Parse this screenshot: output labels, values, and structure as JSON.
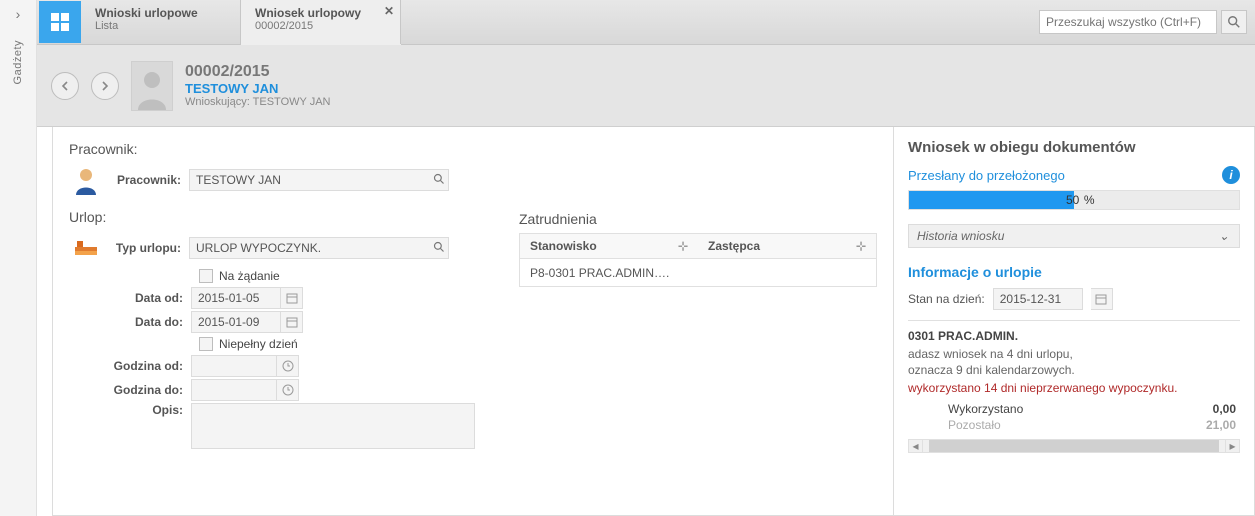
{
  "rail": {
    "label": "Gadżety"
  },
  "tabs": [
    {
      "title": "Wnioski urlopowe",
      "sub": "Lista"
    },
    {
      "title": "Wniosek urlopowy",
      "sub": "00002/2015"
    }
  ],
  "search": {
    "placeholder": "Przeszukaj wszystko (Ctrl+F)"
  },
  "header": {
    "number": "00002/2015",
    "employee": "TESTOWY JAN",
    "requester_label": "Wnioskujący:",
    "requester_value": "TESTOWY JAN"
  },
  "sections": {
    "employee": "Pracownik:",
    "leave": "Urlop:",
    "employment": "Zatrudnienia"
  },
  "form": {
    "employee_label": "Pracownik:",
    "employee_value": "TESTOWY JAN",
    "type_label": "Typ urlopu:",
    "type_value": "URLOP WYPOCZYNK.",
    "on_demand": "Na żądanie",
    "date_from_label": "Data od:",
    "date_from": "2015-01-05",
    "date_to_label": "Data do:",
    "date_to": "2015-01-09",
    "partial_day": "Niepełny dzień",
    "hour_from_label": "Godzina od:",
    "hour_to_label": "Godzina do:",
    "desc_label": "Opis:"
  },
  "employment": {
    "col_position": "Stanowisko",
    "col_substitute": "Zastępca",
    "rows": [
      {
        "position": "P8-0301 PRAC.ADMIN….",
        "substitute": ""
      }
    ]
  },
  "side": {
    "title": "Wniosek w obiegu dokumentów",
    "status": "Przesłany do przełożonego",
    "progress_pct": "50",
    "pct_symbol": "%",
    "history": "Historia wniosku",
    "info_title": "Informacje o urlopie",
    "asof_label": "Stan na dzień:",
    "asof_value": "2015-12-31",
    "position": "0301 PRAC.ADMIN.",
    "note1": "adasz wniosek na 4 dni urlopu,",
    "note2": "oznacza 9 dni kalendarzowych.",
    "alert": "wykorzystano 14 dni nieprzerwanego wypoczynku.",
    "used_label": "Wykorzystano",
    "used_value": "0,00",
    "remaining_label": "Pozostało",
    "remaining_value": "21,00"
  }
}
